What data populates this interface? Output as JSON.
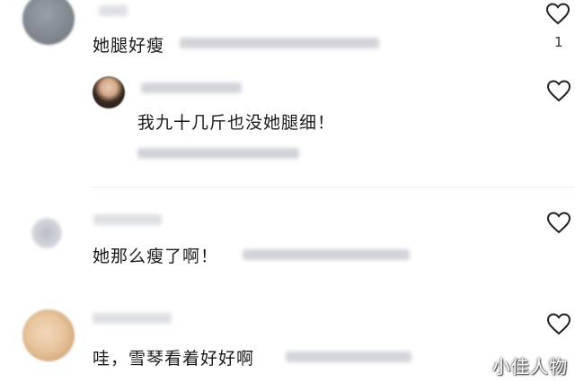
{
  "comments": [
    {
      "text": "她腿好瘦",
      "like_count": "1",
      "icon": "heart-outline-icon"
    },
    {
      "text": "我九十几斤也没她腿细！",
      "icon": "heart-outline-icon"
    },
    {
      "text": "她那么瘦了啊！",
      "icon": "heart-outline-icon"
    },
    {
      "text": "哇，雪琴看着好好啊",
      "icon": "heart-outline-icon"
    }
  ],
  "watermark": "小佳人物",
  "colors": {
    "text": "#1a1a1a",
    "blur_gray": "#c9ccd3",
    "heart_stroke": "#222222"
  }
}
